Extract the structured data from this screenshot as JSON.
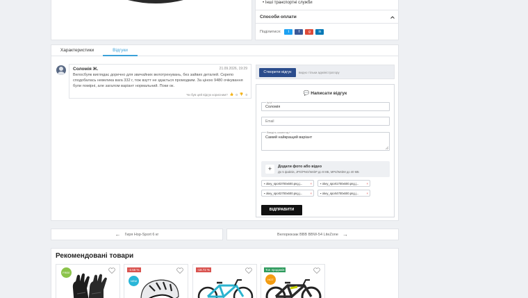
{
  "top_right": {
    "delivery_item": "Інші транспортні служби",
    "payment_methods_label": "Способи оплати",
    "share_label": "Поділитися:",
    "share_colors": [
      "#1da1f2",
      "#3b5998",
      "#dd4b39",
      "#0077b5"
    ],
    "share_icons": [
      "twitter-icon",
      "facebook-icon",
      "google-plus-icon",
      "linkedin-icon"
    ]
  },
  "tabs": [
    {
      "label": "Характеристики",
      "active": false
    },
    {
      "label": "Відгуки",
      "active": true
    }
  ],
  "review": {
    "author": "Соломія Ж.",
    "date": "21.09.2026, 19:29",
    "text": "Велосбуяк виглядає доречно для звичайних велотренувань, без зайвих деталей. Скрепо сподобалась невелика вага 332 г, тож взутт не здається промодким. За ціною 9480 очікування були помірні, але загалом варіант нормальний. Поки ок.",
    "helpful_label": "Чи був цей відгук корисним?",
    "likes": "0",
    "dislikes": "0"
  },
  "review_form": {
    "create_button": "Створити відгук",
    "admin_note": "видно тільки адміністратору",
    "title": "Написати відгук",
    "name_label": "Ім'я*",
    "name_value": "Соломія",
    "email_placeholder": "Email",
    "comment_label": "Введіть коментар*",
    "comment_value": "Самий найкращий варіант",
    "upload_title": "Додати фото або відео",
    "upload_hint": "До 5 файлів, JPG/PNG/WebP до 8 МБ, MP4/WebM до 40 МБ",
    "files": [
      "okey_sport3700x600.png.j...",
      "okey_sport1700x600.png.j...",
      "okey_sport2700x600.png.j...",
      "okey_sport4700x600.png.j..."
    ],
    "submit": "ВІДПРАВИТИ"
  },
  "pager": {
    "prev": "Гиря Hop-Sport 6 кг",
    "next": "Велорюкзак BBB BBW-54 LiteZone"
  },
  "recommended": {
    "title": "Рекомендовані товари",
    "cards": [
      {
        "badge": "",
        "badge_color": "",
        "sticker": "FREE",
        "sticker_color": "#8bc34a",
        "image": "gloves"
      },
      {
        "badge": "-2.56 %",
        "badge_color": "#d9534f",
        "sticker": "NEW",
        "sticker_color": "#29b6d8",
        "image": "helmet"
      },
      {
        "badge": "-18.72 %",
        "badge_color": "#d9534f",
        "sticker": "",
        "sticker_color": "",
        "image": "bike-blue"
      },
      {
        "badge": "Топ продажів",
        "badge_color": "#2e9b5d",
        "sticker": "HOT",
        "sticker_color": "#f39c12",
        "image": "bike-dark"
      }
    ]
  }
}
